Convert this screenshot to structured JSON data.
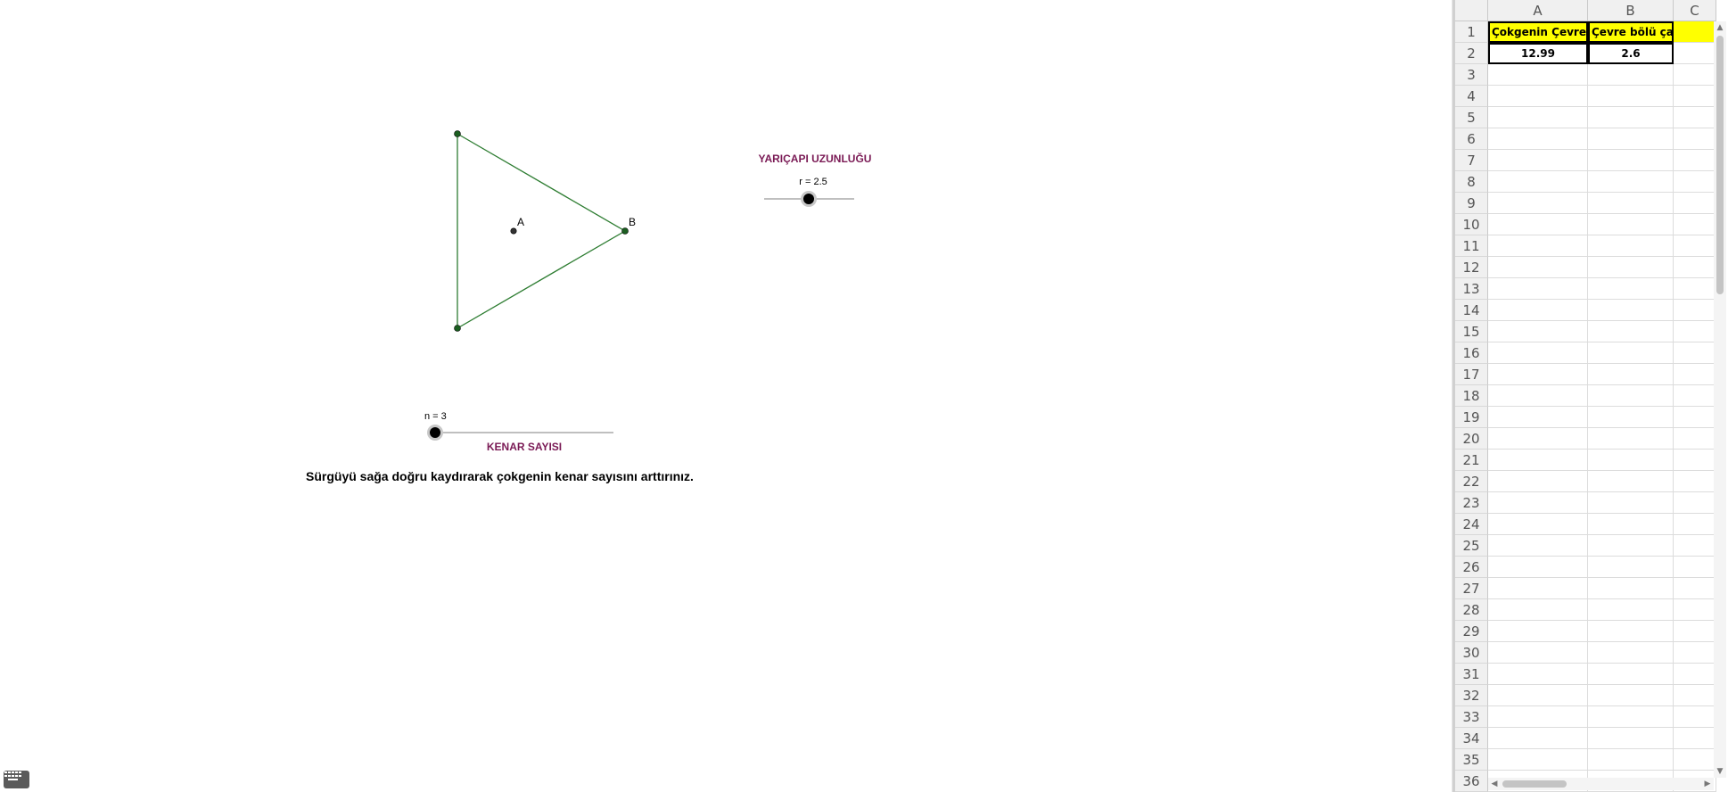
{
  "graphics": {
    "radius_slider": {
      "title": "YARIÇAPI UZUNLUĞU",
      "value_label": "r = 2.5",
      "value": 2.5
    },
    "sides_slider": {
      "title": "KENAR SAYISI",
      "value_label": "n = 3",
      "value": 3
    },
    "points": {
      "a_label": "A",
      "b_label": "B"
    },
    "polygon_color": "#2e7d32",
    "slider_title_color": "#7a1a55",
    "instruction": "Sürgüyü sağa doğru kaydırarak çokgenin kenar sayısını arttırınız."
  },
  "spreadsheet": {
    "columns": [
      "A",
      "B",
      "C"
    ],
    "rows": [
      "1",
      "2",
      "3",
      "4",
      "5",
      "6",
      "7",
      "8",
      "9",
      "10",
      "11",
      "12",
      "13",
      "14",
      "15",
      "16",
      "17",
      "18",
      "19",
      "20",
      "21",
      "22",
      "23",
      "24",
      "25",
      "26",
      "27",
      "28",
      "29",
      "30",
      "31",
      "32",
      "33",
      "34",
      "35",
      "36"
    ],
    "cells": {
      "A1": "Çokgenin Çevresi",
      "B1": "Çevre bölü çap",
      "A2": "12.99",
      "B2": "2.6"
    },
    "highlight_color": "#ffff00"
  }
}
